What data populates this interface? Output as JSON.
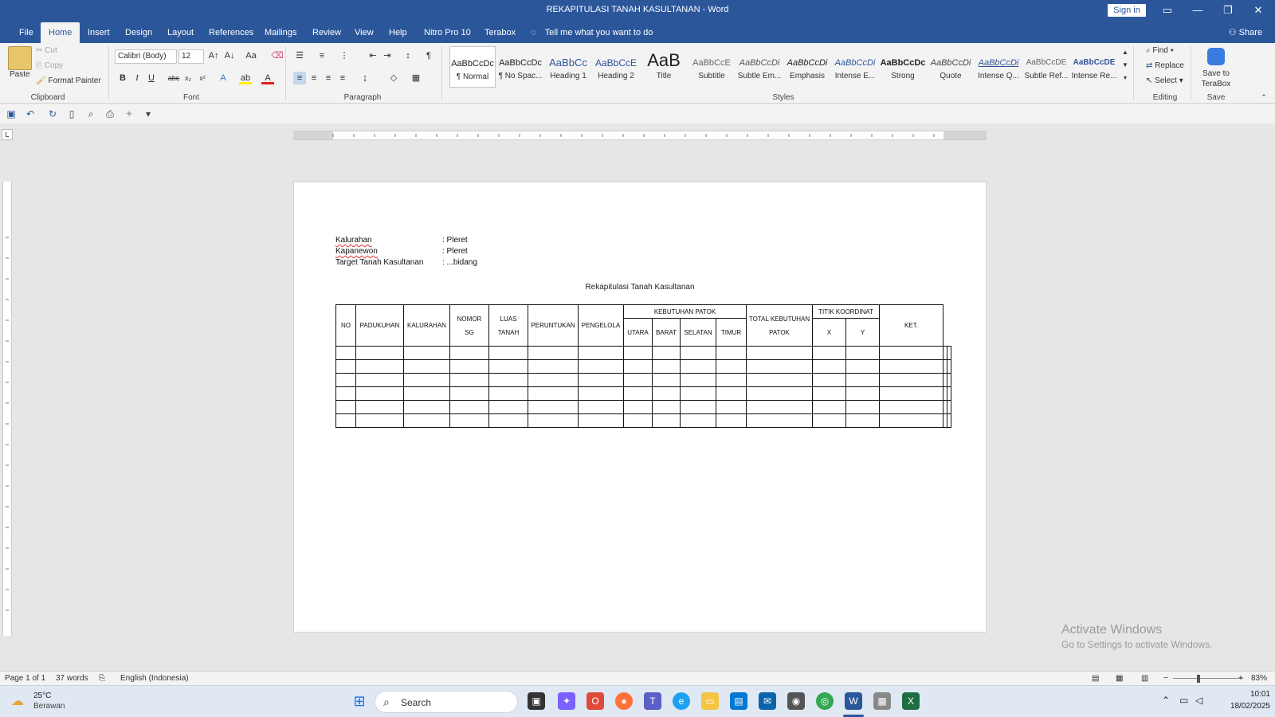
{
  "window": {
    "title": "REKAPITULASI TANAH KASULTANAN  -  Word",
    "signin": "Sign in",
    "minimize": "—",
    "restore": "❐",
    "close": "✕"
  },
  "tabs": [
    "File",
    "Home",
    "Insert",
    "Design",
    "Layout",
    "References",
    "Mailings",
    "Review",
    "View",
    "Help",
    "Nitro Pro 10",
    "Terabox"
  ],
  "tell_me": "Tell me what you want to do",
  "share": "Share",
  "clipboard": {
    "paste": "Paste",
    "cut": "Cut",
    "copy": "Copy",
    "format_painter": "Format Painter",
    "label": "Clipboard"
  },
  "font": {
    "name": "Calibri (Body)",
    "size": "12",
    "label": "Font"
  },
  "paragraph": {
    "label": "Paragraph"
  },
  "styles": {
    "label": "Styles",
    "items": [
      {
        "sample": "AaBbCcDc",
        "name": "¶ Normal"
      },
      {
        "sample": "AaBbCcDc",
        "name": "¶ No Spac..."
      },
      {
        "sample": "AaBbCc",
        "name": "Heading 1"
      },
      {
        "sample": "AaBbCcE",
        "name": "Heading 2"
      },
      {
        "sample": "AaB",
        "name": "Title"
      },
      {
        "sample": "AaBbCcE",
        "name": "Subtitle"
      },
      {
        "sample": "AaBbCcDi",
        "name": "Subtle Em..."
      },
      {
        "sample": "AaBbCcDi",
        "name": "Emphasis"
      },
      {
        "sample": "AaBbCcDi",
        "name": "Intense E..."
      },
      {
        "sample": "AaBbCcDc",
        "name": "Strong"
      },
      {
        "sample": "AaBbCcDi",
        "name": "Quote"
      },
      {
        "sample": "AaBbCcDi",
        "name": "Intense Q..."
      },
      {
        "sample": "AaBbCcDE",
        "name": "Subtle Ref..."
      },
      {
        "sample": "AaBbCcDE",
        "name": "Intense Re..."
      }
    ]
  },
  "editing": {
    "find": "Find",
    "replace": "Replace",
    "select": "Select",
    "label": "Editing"
  },
  "save": {
    "button": "Save to TeraBox",
    "label": "Save"
  },
  "document": {
    "meta": [
      {
        "label": "Kalurahan",
        "value": ": Pleret"
      },
      {
        "label": "Kapanewon",
        "value": ": Pleret"
      },
      {
        "label": "Target Tanah Kasultanan",
        "value": ": ...bidang"
      }
    ],
    "heading": "Rekapitulasi Tanah Kasultanan",
    "table": {
      "headers": {
        "no": "NO",
        "padukuhan": "PADUKUHAN",
        "kalurahan": "KALURAHAN",
        "nomor_sg": "NOMOR SG",
        "luas_tanah": "LUAS TANAH",
        "peruntukan": "PERUNTUKAN",
        "pengelola": "PENGELOLA",
        "kebutuhan_patok": "KEBUTUHAN PATOK",
        "utara": "UTARA",
        "barat": "BARAT",
        "selatan": "SELATAN",
        "timur": "TIMUR",
        "total": "TOTAL KEBUTUHAN PATOK",
        "titik_koordinat": "TITIK KOORDINAT",
        "x": "X",
        "y": "Y",
        "ket": "KET."
      },
      "empty_rows": 6
    }
  },
  "activate_windows": {
    "line1": "Activate Windows",
    "line2": "Go to Settings to activate Windows."
  },
  "statusbar": {
    "page": "Page 1 of 1",
    "words": "37 words",
    "language": "English (Indonesia)",
    "zoom": "83%"
  },
  "taskbar": {
    "weather_temp": "25°C",
    "weather_desc": "Berawan",
    "search": "Search",
    "time": "10:01",
    "date": "18/02/2025"
  }
}
